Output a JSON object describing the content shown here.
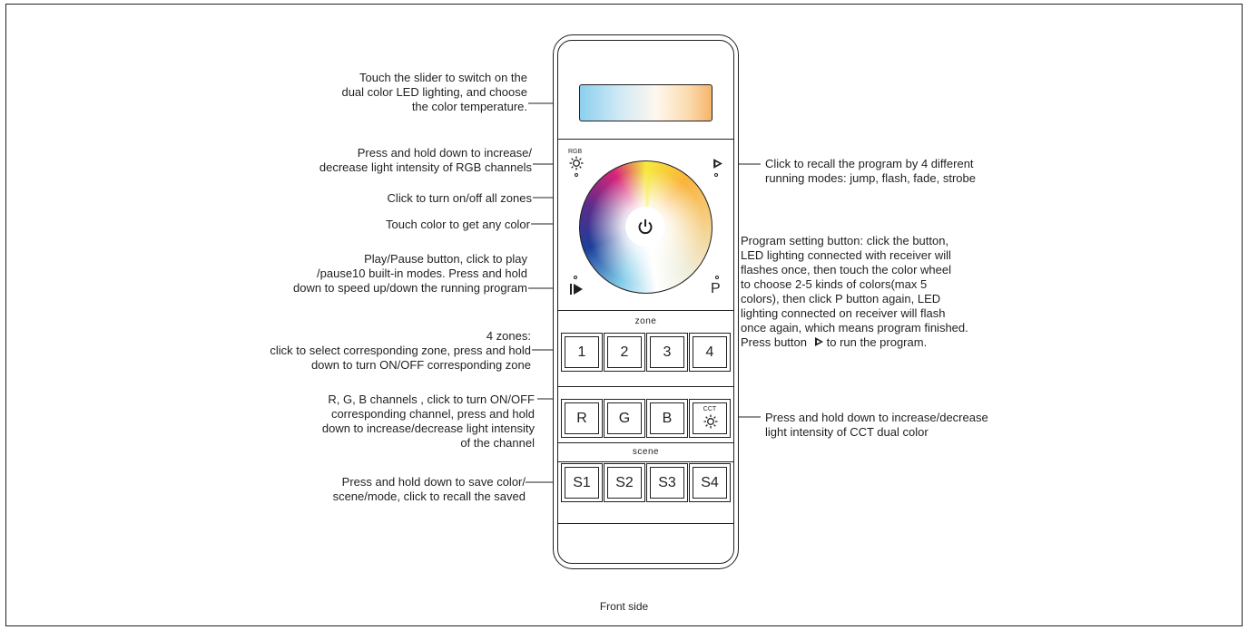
{
  "annotations": {
    "slider": [
      "Touch the slider to switch on the",
      "dual color LED lighting, and choose",
      "the color temperature."
    ],
    "rgb_brightness": [
      "Press and hold down to increase/",
      "decrease light intensity of RGB channels"
    ],
    "power": [
      "Click  to turn on/off all zones"
    ],
    "wheel": [
      "Touch color to get any color"
    ],
    "play_pause": [
      "Play/Pause button, click to play",
      "/pause10 built-in modes. Press and hold",
      "down to speed up/down the running program"
    ],
    "zones": [
      "4 zones:",
      "click to select corresponding zone, press and hold",
      "down to turn ON/OFF corresponding zone"
    ],
    "rgb_channels": [
      "R, G, B channels  , click to turn ON/OFF",
      "corresponding channel, press and hold",
      "down to increase/decrease light intensity",
      "of the channel"
    ],
    "scenes": [
      "Press and hold down to save color/",
      "scene/mode, click to recall the saved"
    ],
    "program_recall": [
      "Click to recall the program by 4 different",
      "running modes: jump, flash, fade, strobe"
    ],
    "program_setting": [
      "Program setting button: click the button,",
      "LED lighting connected with receiver will",
      "flashes once, then touch the color wheel",
      "to choose 2-5 kinds of colors(max 5",
      "colors), then click P button again, LED",
      "lighting connected on receiver will flash",
      "once again, which means program finished."
    ],
    "program_setting_last_pre": "Press button",
    "program_setting_last_post": "to run the program.",
    "cct": [
      "Press and hold down to increase/decrease",
      "light intensity of CCT dual color"
    ]
  },
  "remote": {
    "rgb_label": "RGB",
    "cct_label": "CCT",
    "p_label": "P",
    "zone_label": "zone",
    "zone_keys": [
      "1",
      "2",
      "3",
      "4"
    ],
    "channel_keys": [
      "R",
      "G",
      "B"
    ],
    "scene_label": "scene",
    "scene_keys": [
      "S1",
      "S2",
      "S3",
      "S4"
    ]
  },
  "caption": "Front side"
}
